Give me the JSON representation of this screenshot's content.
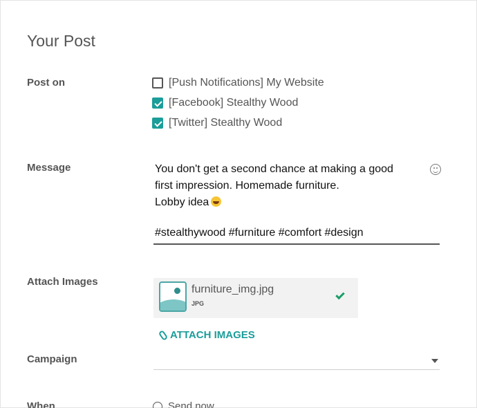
{
  "title": "Your Post",
  "post_on": {
    "label": "Post on",
    "options": [
      {
        "label": "[Push Notifications] My Website",
        "checked": false
      },
      {
        "label": "[Facebook] Stealthy Wood",
        "checked": true
      },
      {
        "label": "[Twitter] Stealthy Wood",
        "checked": true
      }
    ]
  },
  "message": {
    "label": "Message",
    "lines": [
      "You don't get a second chance at making a good",
      "first impression. Homemade furniture.",
      "Lobby idea"
    ],
    "hashtags": "#stealthywood #furniture #comfort #design",
    "emoji_icon": "smiley-icon"
  },
  "attach_images": {
    "label": "Attach Images",
    "file": {
      "name": "furniture_img.jpg",
      "type": "JPG",
      "status_icon": "checkmark-icon"
    },
    "link_label": "ATTACH IMAGES"
  },
  "campaign": {
    "label": "Campaign",
    "value": ""
  },
  "when": {
    "label": "When",
    "option": "Send now"
  },
  "colors": {
    "accent": "#1b9d9a",
    "label": "#555555"
  }
}
